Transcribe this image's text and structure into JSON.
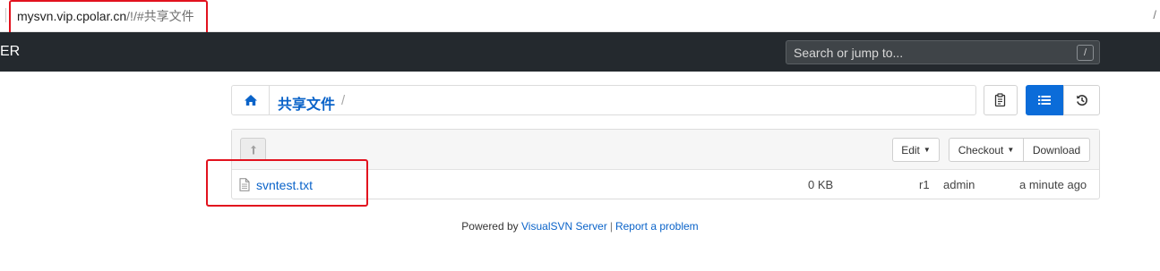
{
  "browser": {
    "url_host": "mysvn.vip.cpolar.cn",
    "url_path": "/!/#共享文件",
    "right_mark": "/"
  },
  "topnav": {
    "brand_fragment": "ER",
    "search_placeholder": "Search or jump to...",
    "search_shortcut": "/"
  },
  "breadcrumb": {
    "home_icon": "home-icon",
    "items": [
      "共享文件"
    ],
    "separator": "/"
  },
  "toolbar": {
    "edit_label": "Edit",
    "checkout_label": "Checkout",
    "download_label": "Download",
    "up_icon": "level-up-icon",
    "clipboard_icon": "clipboard-icon",
    "list_view_icon": "list-icon",
    "history_icon": "history-icon"
  },
  "files": [
    {
      "name": "svntest.txt",
      "size": "0 KB",
      "revision": "r1",
      "author": "admin",
      "modified": "a minute ago",
      "icon": "file-icon"
    }
  ],
  "footer": {
    "powered_by": "Powered by",
    "server_link": "VisualSVN Server",
    "separator": "|",
    "report_link": "Report a problem"
  },
  "colors": {
    "nav_bg": "#24292e",
    "link": "#0a63c9",
    "accent_button": "#0b6cd9",
    "annotation": "#e2121e"
  }
}
